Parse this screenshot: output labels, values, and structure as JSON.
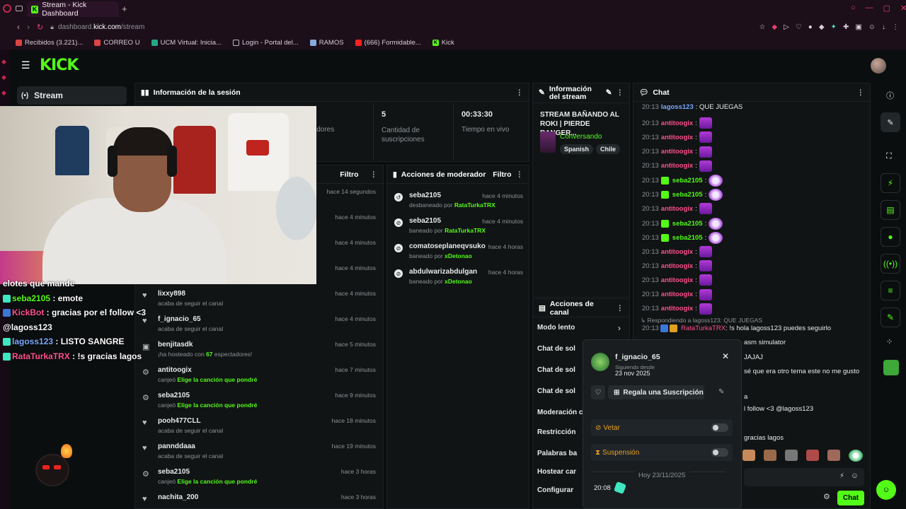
{
  "browser": {
    "tab_title": "Stream - Kick Dashboard",
    "url_host": "dashboard.",
    "url_domain": "kick.com",
    "url_path": "/stream",
    "bookmarks": [
      "Recibidos (3.221)...",
      "CORREO U",
      "UCM Virtual: Inicia...",
      "Login - Portal del...",
      "RAMOS",
      "(666) Formidable...",
      "Kick"
    ]
  },
  "nav": {
    "stream_label": "Stream"
  },
  "session": {
    "title": "Información de la sesión",
    "stat_label_partial": "idores",
    "subs_value": "5",
    "subs_label": "Cantidad de suscripciones",
    "time_value": "00:33:30",
    "time_label": "Tiempo en vivo"
  },
  "activity": {
    "filter": "Filtro",
    "items": [
      {
        "time": "hace 14 segundos"
      },
      {
        "time": "hace 4 minutos"
      },
      {
        "time": "hace 4 minutos"
      },
      {
        "time": "hace 4 minutos"
      },
      {
        "user": "lixxy898",
        "desc": "acaba de seguir el canal",
        "time": "hace 4 minutos",
        "icon": "heart"
      },
      {
        "user": "f_ignacio_65",
        "desc": "acaba de seguir el canal",
        "time": "hace 4 minutos",
        "icon": "heart"
      },
      {
        "user": "benjitasdk",
        "desc_pre": "¡ha hosteado con ",
        "desc_num": "67",
        "desc_post": " espectadores!",
        "time": "hace 5 minutos",
        "icon": "host"
      },
      {
        "user": "antitoogix",
        "desc_pre": "canjeó ",
        "desc_hl": "Elige la canción que pondré",
        "time": "hace 7 minutos",
        "icon": "reward"
      },
      {
        "user": "seba2105",
        "desc_pre": "canjeó ",
        "desc_hl": "Elige la canción que pondré",
        "time": "hace 9 minutos",
        "icon": "reward"
      },
      {
        "user": "pooh477CLL",
        "desc": "acaba de seguir el canal",
        "time": "hace 18 minutos",
        "icon": "heart"
      },
      {
        "user": "pannddaaa",
        "desc": "acaba de seguir el canal",
        "time": "hace 19 minutos",
        "icon": "heart"
      },
      {
        "user": "seba2105",
        "desc_pre": "canjeó ",
        "desc_hl": "Elige la canción que pondré",
        "time": "hace 3 horas",
        "icon": "reward"
      },
      {
        "user": "nachita_200",
        "time": "hace 3 horas",
        "icon": "heart"
      }
    ]
  },
  "modactions": {
    "title": "Acciones de moderador",
    "filter": "Filtro",
    "items": [
      {
        "user": "seba2105",
        "action": "desbaneado por ",
        "mod": "RataTurkaTRX",
        "time": "hace 4 minutos"
      },
      {
        "user": "seba2105",
        "action": "baneado por ",
        "mod": "RataTurkaTRX",
        "time": "hace 4 minutos"
      },
      {
        "user": "comatoseplaneqvsuko",
        "action": "baneado por ",
        "mod": "xDetonao",
        "time": "hace 4 horas"
      },
      {
        "user": "abdulwarizabdulgan",
        "action": "baneado por ",
        "mod": "xDetonao",
        "time": "hace 4 horas"
      }
    ]
  },
  "streaminfo": {
    "title": "Información del stream",
    "stream_title": "STREAM BAÑANDO AL ROKI | PIERDE RANGER...",
    "category": "Conversando",
    "tags": [
      "Spanish",
      "Chile"
    ]
  },
  "channel_actions": {
    "title": "Acciones de canal",
    "items": [
      "Modo lento",
      "Chat de sol",
      "Chat de sol",
      "Chat de sol",
      "Moderación con IA",
      "Restricción",
      "Palabras ba",
      "Hostear car",
      "Configurar"
    ]
  },
  "chat": {
    "title": "Chat",
    "messages": [
      {
        "time": "20:13",
        "user": "lagoss123",
        "text": ": QUE JUEGAS",
        "color": "#7aa7ff"
      },
      {
        "time": "20:13",
        "user": "antitoogix",
        "emote": "1",
        "color": "#ff4f8b"
      },
      {
        "time": "20:13",
        "user": "antitoogix",
        "emote": "1",
        "color": "#ff4f8b"
      },
      {
        "time": "20:13",
        "user": "antitoogix",
        "emote": "1",
        "color": "#ff4f8b"
      },
      {
        "time": "20:13",
        "user": "antitoogix",
        "emote": "1",
        "color": "#ff4f8b"
      },
      {
        "time": "20:13",
        "user": "seba2105",
        "emote": "2",
        "color": "#53fc18"
      },
      {
        "time": "20:13",
        "user": "seba2105",
        "emote": "2",
        "color": "#53fc18"
      },
      {
        "time": "20:13",
        "user": "antitoogix",
        "emote": "1",
        "color": "#ff4f8b"
      },
      {
        "time": "20:13",
        "user": "seba2105",
        "emote": "2",
        "color": "#53fc18"
      },
      {
        "time": "20:13",
        "user": "seba2105",
        "emote": "2",
        "color": "#53fc18"
      },
      {
        "time": "20:13",
        "user": "antitoogix",
        "emote": "1",
        "color": "#ff4f8b"
      },
      {
        "time": "20:13",
        "user": "antitoogix",
        "emote": "1",
        "color": "#ff4f8b"
      },
      {
        "time": "20:13",
        "user": "antitoogix",
        "emote": "1",
        "color": "#ff4f8b"
      },
      {
        "time": "20:13",
        "user": "antitoogix",
        "emote": "1",
        "color": "#ff4f8b"
      },
      {
        "time": "20:13",
        "user": "antitoogix",
        "emote": "1",
        "color": "#ff4f8b"
      }
    ],
    "reply_to": "Respondiendo a lagoss123: QUE JUEGAS",
    "reply_time": "20:13",
    "reply_user": "RataTurkaTRX",
    "reply_text": ": !s hola lagoss123 puedes seguirlo",
    "partial_lines": [
      "asm simulator",
      "JAJAJ",
      "sé que era otro tema este no me gusto",
      "a",
      "l follow <3 @lagoss123",
      "gracias lagos"
    ],
    "send": "Chat"
  },
  "popup": {
    "user": "f_ignacio_65",
    "following_label": "Siguiendo desde",
    "following_date": "23 nov 2025",
    "gift": "Regala una Suscripción",
    "ban": "Vetar",
    "timeout": "Suspensión",
    "day": "Hoy 23/11/2025",
    "msg_time": "20:08"
  },
  "overlay_chat": [
    {
      "text": "elotes que mande",
      "color": "#ffffff"
    },
    {
      "user": "seba2105",
      "text": " : emote",
      "color": "#53fc18"
    },
    {
      "user": "KickBot",
      "text": " : gracias por el follow <3",
      "color": "#ff4f8b"
    },
    {
      "text": "@lagoss123",
      "color": "#ffffff"
    },
    {
      "user": "lagoss123",
      "text": " : LISTO SANGRE",
      "color": "#7aa7ff"
    },
    {
      "user": "RataTurkaTRX",
      "text": " : !s gracias lagos",
      "color": "#ff4f8b"
    }
  ]
}
